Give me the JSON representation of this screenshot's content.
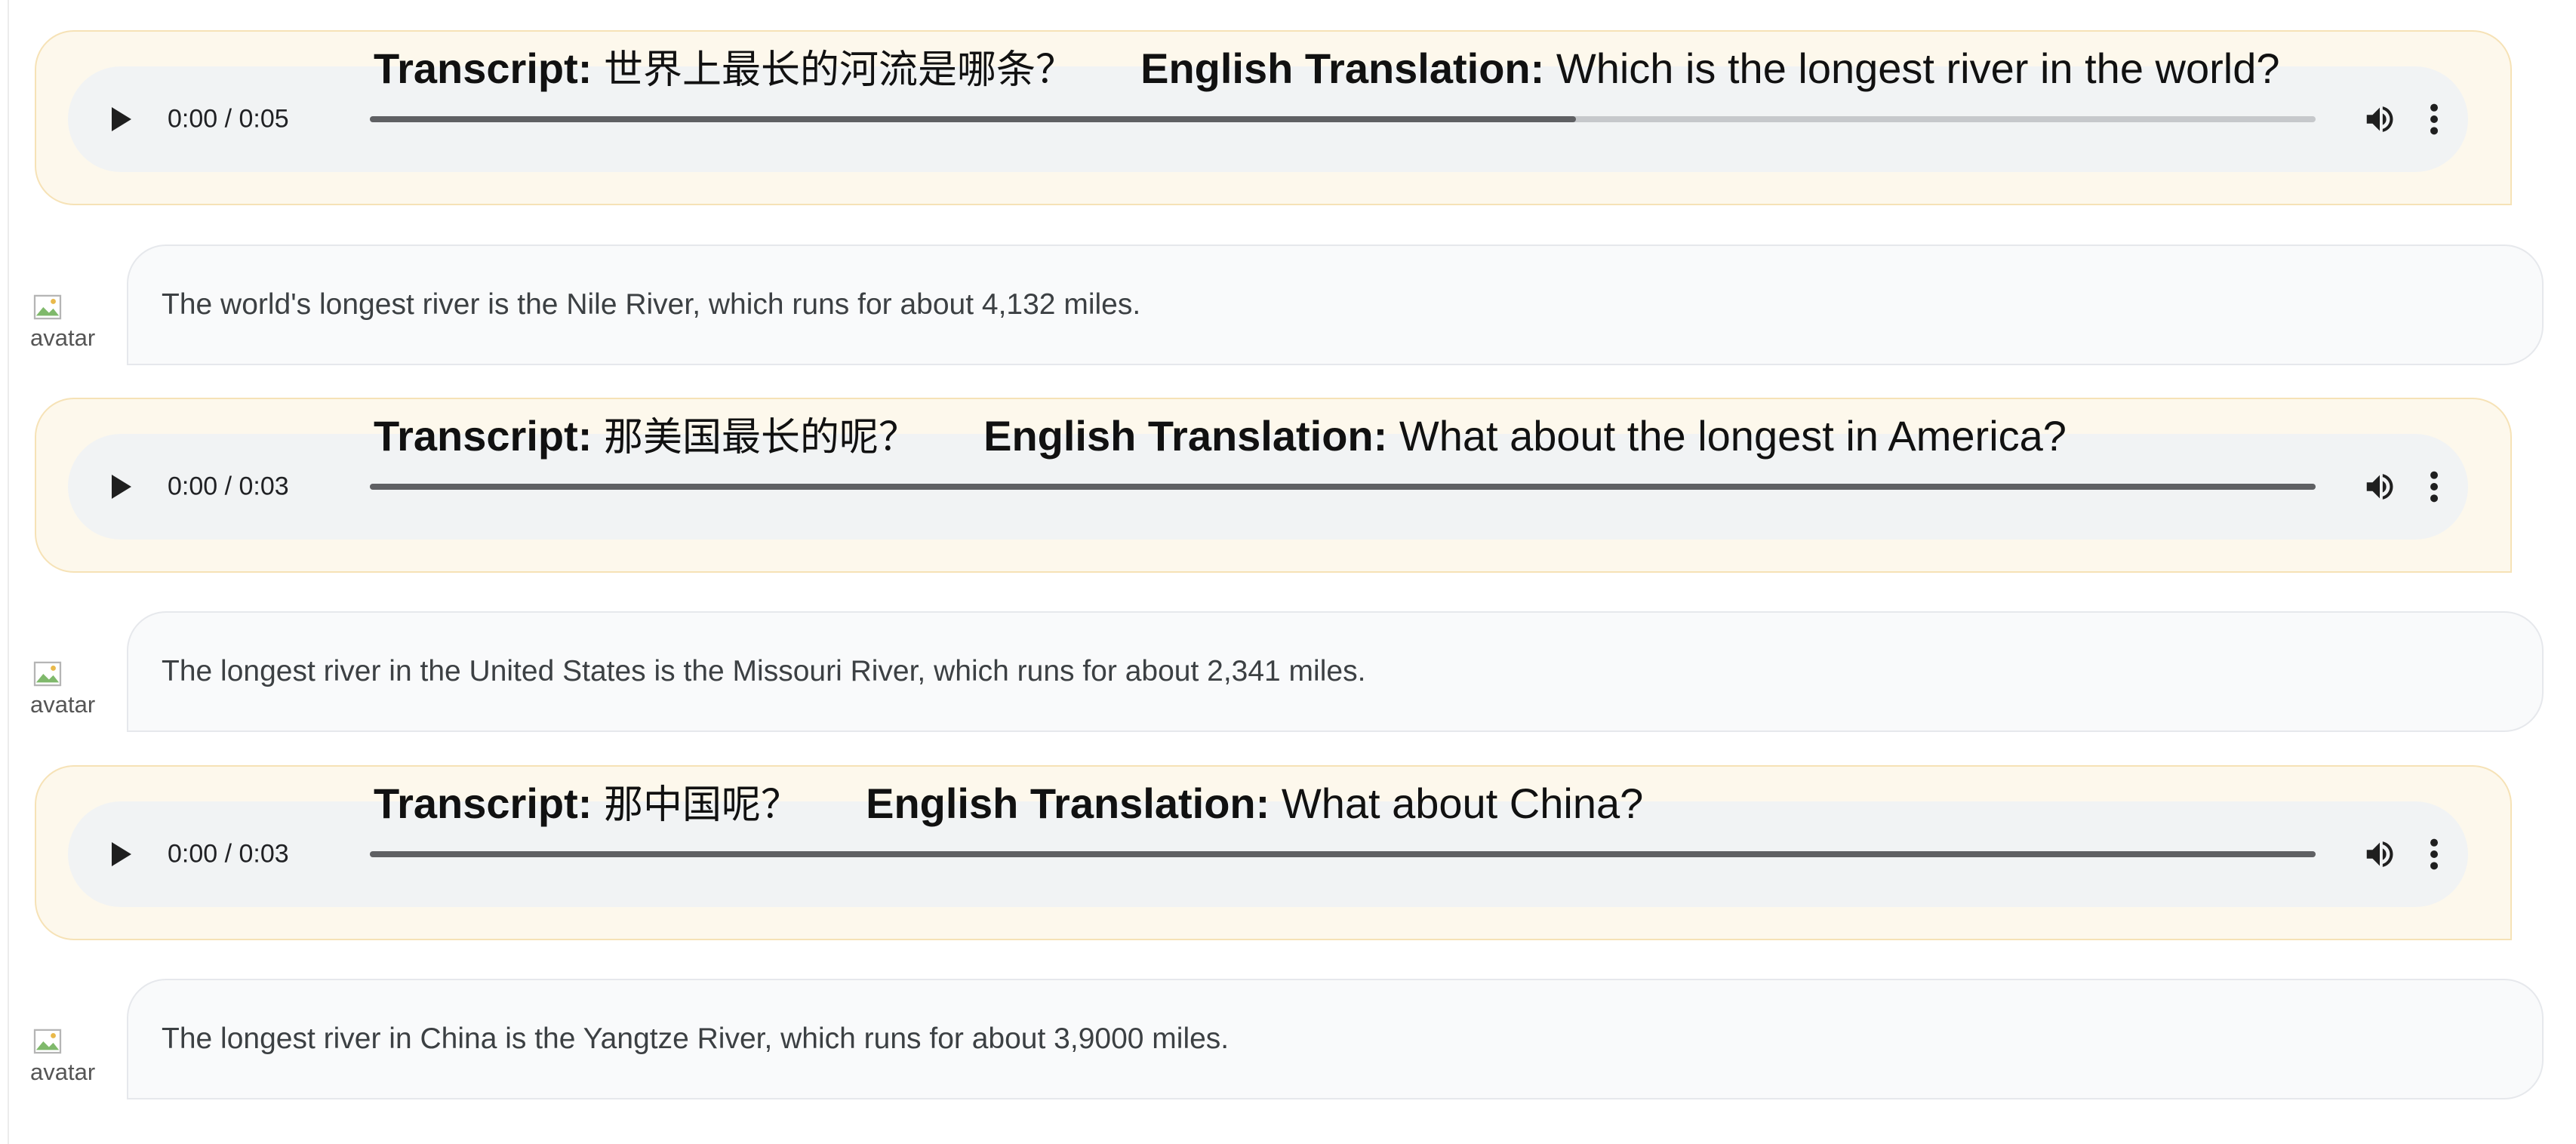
{
  "colors": {
    "user_bubble_bg": "#fdf8ec",
    "user_bubble_border": "#f6e2b6",
    "player_bg": "#f1f3f4",
    "bot_bubble_bg": "#f9fafb",
    "bot_bubble_border": "#e6e8ec"
  },
  "labels": {
    "transcript": "Transcript:",
    "translation": "English Translation:"
  },
  "icons": {
    "play": "play-icon",
    "volume": "volume-icon",
    "menu": "more-vert-icon",
    "avatar": "broken-image-icon"
  },
  "messages": [
    {
      "role": "user",
      "audio": {
        "time": "0:00 / 0:05",
        "progress": 0.62
      },
      "transcript": "世界上最长的河流是哪条？",
      "translation": "Which is the longest river in the world?"
    },
    {
      "role": "bot",
      "avatar_alt": "avatar",
      "text": "The world's longest river is the Nile River, which runs for about 4,132 miles."
    },
    {
      "role": "user",
      "audio": {
        "time": "0:00 / 0:03",
        "progress": 1.0
      },
      "transcript": "那美国最长的呢？",
      "translation": "What about the longest in America?"
    },
    {
      "role": "bot",
      "avatar_alt": "avatar",
      "text": "The longest river in the United States is the Missouri River, which runs for about 2,341 miles."
    },
    {
      "role": "user",
      "audio": {
        "time": "0:00 / 0:03",
        "progress": 1.0
      },
      "transcript": "那中国呢？",
      "translation": "What about China?"
    },
    {
      "role": "bot",
      "avatar_alt": "avatar",
      "text": "The longest river in China is the Yangtze River, which runs for about 3,9000 miles."
    }
  ]
}
